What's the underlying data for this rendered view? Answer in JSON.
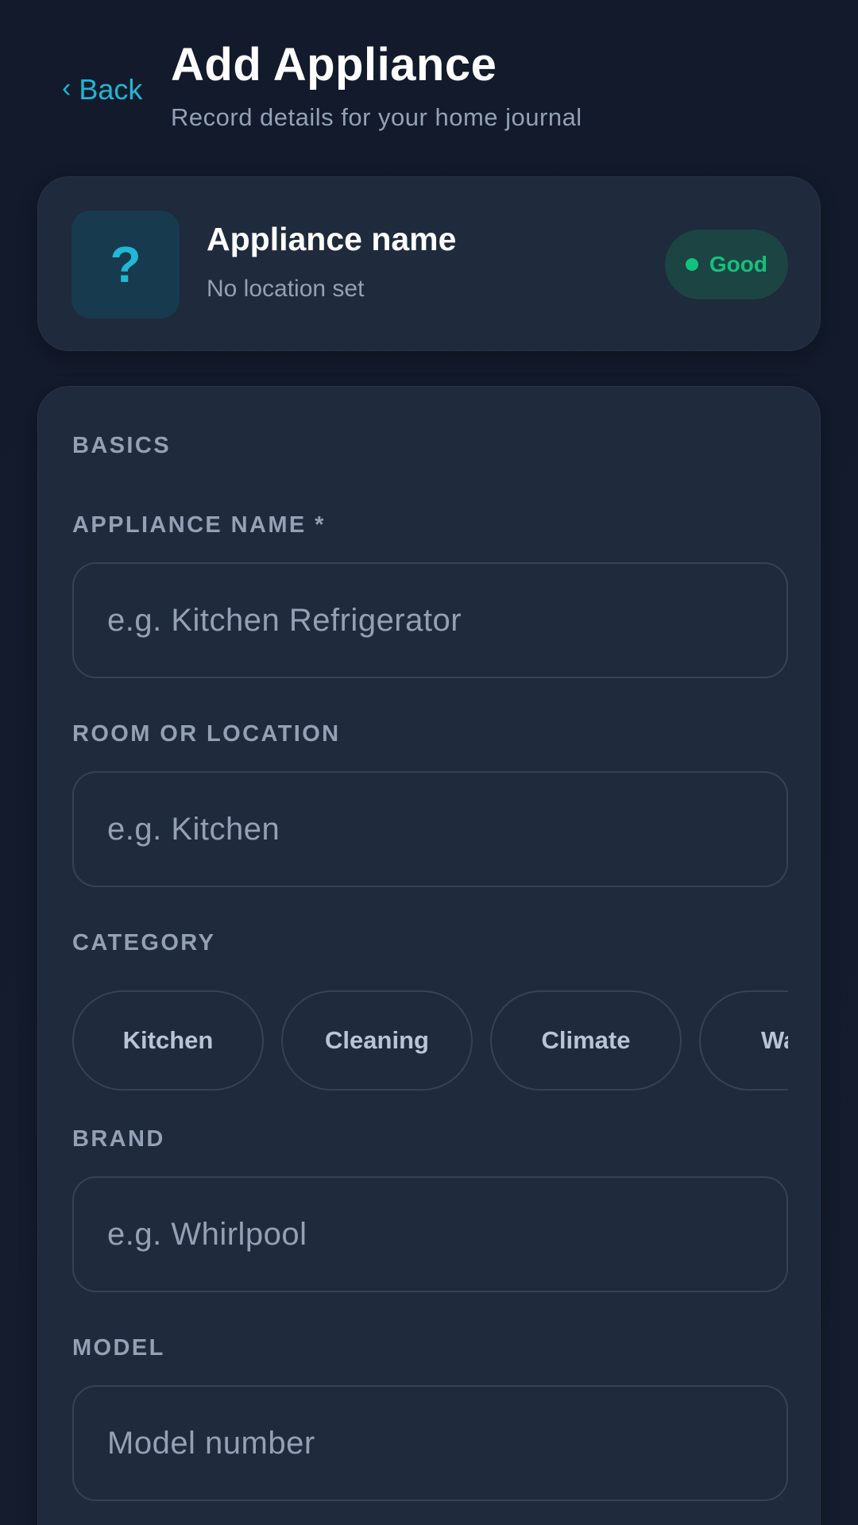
{
  "header": {
    "back_label": "Back",
    "title": "Add Appliance",
    "subtitle": "Record details for your home journal"
  },
  "preview": {
    "icon": "question-mark-icon",
    "icon_glyph": "?",
    "name": "Appliance name",
    "location": "No location set",
    "status": "Good",
    "status_color": "#13c17e"
  },
  "form": {
    "section_title": "BASICS",
    "appliance_name": {
      "label": "APPLIANCE NAME *",
      "placeholder": "e.g. Kitchen Refrigerator",
      "value": ""
    },
    "room": {
      "label": "ROOM OR LOCATION",
      "placeholder": "e.g. Kitchen",
      "value": ""
    },
    "category": {
      "label": "CATEGORY",
      "options": [
        "Kitchen",
        "Cleaning",
        "Climate",
        "Water"
      ]
    },
    "brand": {
      "label": "BRAND",
      "placeholder": "e.g. Whirlpool",
      "value": ""
    },
    "model": {
      "label": "MODEL",
      "placeholder": "Model number",
      "value": ""
    }
  },
  "colors": {
    "accent": "#1fb6d3",
    "background": "#121a2b",
    "card": "#1f2a3c",
    "muted_text": "#93a1b6",
    "border": "#35425a"
  }
}
